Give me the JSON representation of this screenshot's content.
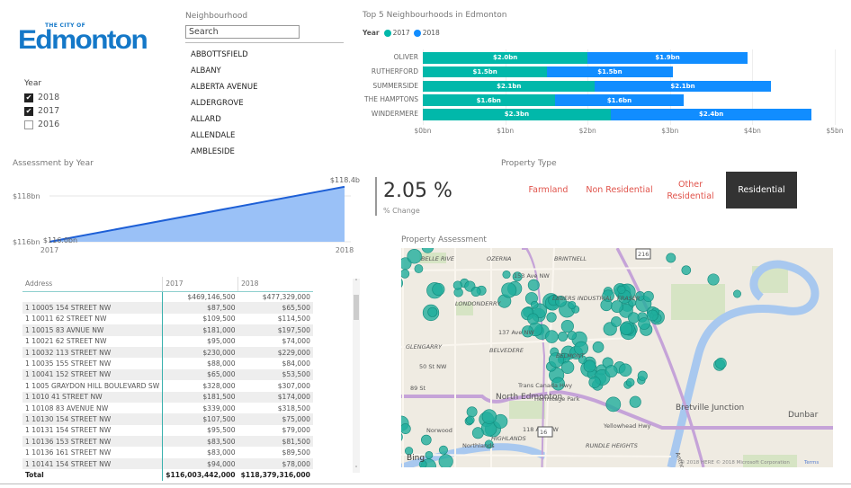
{
  "logo": {
    "line1": "THE CITY OF",
    "line2": "Edmonton"
  },
  "year_slicer": {
    "title": "Year",
    "items": [
      {
        "label": "2018",
        "checked": true
      },
      {
        "label": "2017",
        "checked": true
      },
      {
        "label": "2016",
        "checked": false
      }
    ]
  },
  "neighbourhood": {
    "title": "Neighbourhood",
    "search_placeholder": "Search",
    "items": [
      "ABBOTTSFIELD",
      "ALBANY",
      "ALBERTA AVENUE",
      "ALDERGROVE",
      "ALLARD",
      "ALLENDALE",
      "AMBLESIDE"
    ]
  },
  "colors": {
    "y2017": "#01b8aa",
    "y2018": "#118dff",
    "area_fill": "#9ac1f7",
    "area_line": "#1d5fd6",
    "selected_button": "#333333",
    "button_text": "#e0534b"
  },
  "chart_data": [
    {
      "type": "bar",
      "orientation": "horizontal",
      "stacked": true,
      "title": "Top 5 Neighbourhoods in Edmonton",
      "legend_title": "Year",
      "legend_position": "top-left",
      "categories": [
        "OLIVER",
        "RUTHERFORD",
        "SUMMERSIDE",
        "THE HAMPTONS",
        "WINDERMERE"
      ],
      "series": [
        {
          "name": "2017",
          "values": [
            2.0,
            1.51,
            2.09,
            1.6,
            2.28
          ],
          "labels": [
            "$2.0bn",
            "$1.5bn",
            "$2.1bn",
            "$1.6bn",
            "$2.3bn"
          ]
        },
        {
          "name": "2018",
          "values": [
            1.94,
            1.52,
            2.13,
            1.57,
            2.44
          ],
          "labels": [
            "$1.9bn",
            "$1.5bn",
            "$2.1bn",
            "$1.6bn",
            "$2.4bn"
          ]
        }
      ],
      "xlim": [
        0,
        5
      ],
      "xticks": [
        "$0bn",
        "$1bn",
        "$2bn",
        "$3bn",
        "$4bn",
        "$5bn"
      ],
      "grid": true
    },
    {
      "type": "area",
      "title": "Assessment by Year",
      "x": [
        "2017",
        "2018"
      ],
      "values": [
        116.0,
        118.4
      ],
      "labels": [
        "$116.0bn",
        "$118.4bn"
      ],
      "ylim": [
        116,
        118.4
      ],
      "yticks": [
        {
          "v": 116,
          "label": "$116bn"
        },
        {
          "v": 118,
          "label": "$118bn"
        }
      ],
      "grid": true
    }
  ],
  "kpi": {
    "value": "2.05 %",
    "label": "% Change"
  },
  "property_type": {
    "title": "Property Type",
    "options": [
      {
        "label": "Farmland",
        "selected": false
      },
      {
        "label": "Non Residential",
        "selected": false
      },
      {
        "label": "Other Residential",
        "selected": false
      },
      {
        "label": "Residential",
        "selected": true
      }
    ]
  },
  "map": {
    "title": "Property Assessment",
    "labels": [
      "BELLE RIVE",
      "OZERNA",
      "BRINTNELL",
      "153 Ave NW",
      "LONDONDERRY",
      "EBBERS INDUSTRIAL",
      "FRASER",
      "137 Ave NW",
      "GLENGARRY",
      "BELVEDERE",
      "BELMONT",
      "50 St NW",
      "89 St",
      "North Edmonton",
      "Trans Canada Hwy",
      "Bretville Junction",
      "Dunbar",
      "Norwood",
      "HIGHLANDS",
      "Northlands",
      "118 Ave NW",
      "RUNDLE HEIGHTS",
      "Anthony Henday Dr",
      "Hermitage Park",
      "Yellowhead Hwy",
      "216",
      "16"
    ],
    "brand": "Bing",
    "copyright": "© 2018 HERE © 2018 Microsoft Corporation",
    "terms": "Terms"
  },
  "table": {
    "headers": [
      "Address",
      "2017",
      "2018"
    ],
    "rows": [
      [
        "",
        "$469,146,500",
        "$477,329,000"
      ],
      [
        "1 10005 154 STREET NW",
        "$87,500",
        "$65,500"
      ],
      [
        "1 10011 62 STREET NW",
        "$109,500",
        "$114,500"
      ],
      [
        "1 10015 83 AVNUE NW",
        "$181,000",
        "$197,500"
      ],
      [
        "1 10021 62 STREET NW",
        "$95,000",
        "$74,000"
      ],
      [
        "1 10032 113 STREET NW",
        "$230,000",
        "$229,000"
      ],
      [
        "1 10035 155 STREET NW",
        "$88,000",
        "$84,000"
      ],
      [
        "1 10041 152 STREET NW",
        "$65,000",
        "$53,500"
      ],
      [
        "1 1005 GRAYDON HILL BOULEVARD SW",
        "$328,000",
        "$307,000"
      ],
      [
        "1 1010 41 STREET NW",
        "$181,500",
        "$174,000"
      ],
      [
        "1 10108 83 AVENUE NW",
        "$339,000",
        "$318,500"
      ],
      [
        "1 10130 154 STREET NW",
        "$107,500",
        "$75,000"
      ],
      [
        "1 10131 154 STREET NW",
        "$95,500",
        "$79,000"
      ],
      [
        "1 10136 153 STREET NW",
        "$83,500",
        "$81,500"
      ],
      [
        "1 10136 161 STREET NW",
        "$83,000",
        "$89,500"
      ],
      [
        "1 10141 154 STREET NW",
        "$94,000",
        "$78,000"
      ]
    ],
    "total": [
      "Total",
      "$116,003,442,000",
      "$118,379,316,000"
    ]
  }
}
